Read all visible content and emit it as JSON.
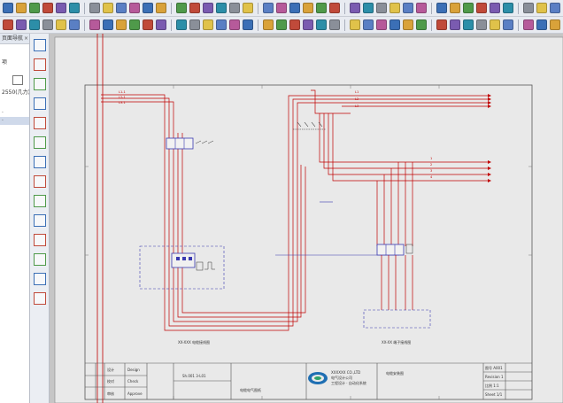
{
  "colors": {
    "canvas_background": "#c6c6c6",
    "sheet_background": "#e9e9e9",
    "wire_red": "#c00000",
    "wire_blue": "#3a3ab0",
    "frame_line": "#555555",
    "toolbar_background": "#e8ebf1",
    "selection_highlight": "#cfd9ea"
  },
  "icons": {
    "toolbar_top": [
      "new-file-icon",
      "open-folder-icon",
      "save-icon",
      "undo-icon",
      "redo-icon",
      "cut-icon",
      "copy-icon",
      "paste-icon",
      "print-icon",
      "preview-icon",
      "zoom-in-icon",
      "zoom-out-icon",
      "zoom-fit-icon",
      "refresh-icon",
      "settings-icon"
    ],
    "vertical_tools": [
      "select-arrow-icon",
      "line-tool-icon",
      "rectangle-tool-icon",
      "circle-tool-icon",
      "arc-tool-icon",
      "text-tool-icon",
      "wire-tool-icon",
      "symbol-tool-icon",
      "terminal-tool-icon",
      "bus-tool-icon",
      "cable-tool-icon",
      "dimension-tool-icon",
      "measure-tool-icon",
      "delete-tool-icon"
    ]
  },
  "left_panel": {
    "header_label": "页面导航",
    "close_label": "×",
    "items": [
      "项",
      "",
      "",
      "2550(几力)",
      "·",
      "·"
    ]
  },
  "drawing": {
    "left_caption": "XX-XXX 电缆接线图",
    "right_caption": "XX-XX 端子接线图",
    "title_block": {
      "drawing_number": "Sh.001 3-L01",
      "drawing_title": "电缆电气图纸",
      "right_title": "电缆安装图",
      "company_line_1": "XXXXXX CO.,LTD",
      "company_line_2": "电气设计公司",
      "company_line_3": "工程设计 · 自动化系统",
      "rows": [
        {
          "mark": "设计",
          "role": "Design"
        },
        {
          "mark": "校对",
          "role": "Check"
        },
        {
          "mark": "审核",
          "role": "Approve"
        }
      ],
      "right_labels": [
        "图号 A001",
        "Revision 1",
        "比例 1:1",
        "Sheet 1/1"
      ]
    }
  }
}
